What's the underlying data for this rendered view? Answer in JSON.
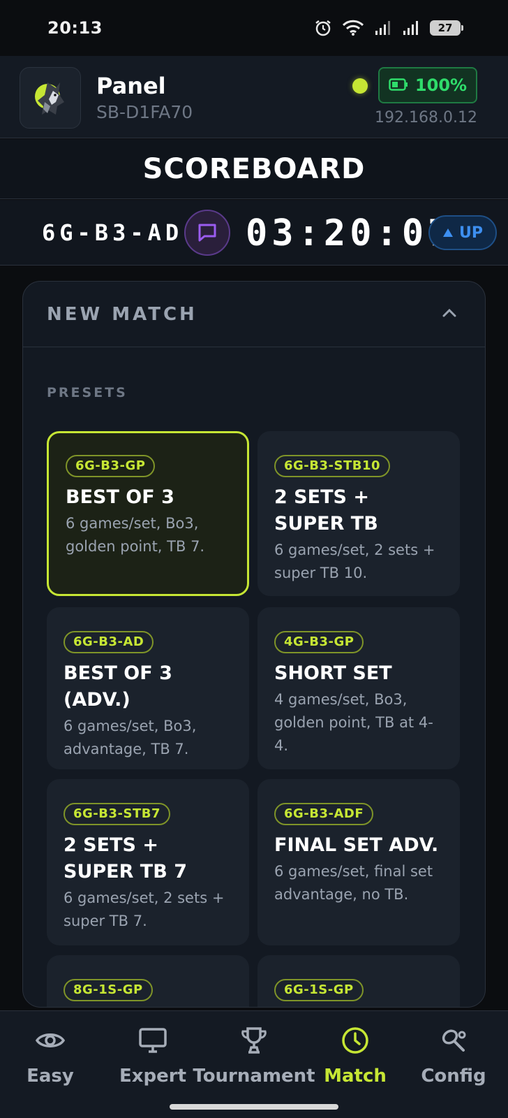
{
  "status_bar": {
    "time": "20:13",
    "battery_level": "27",
    "icons": [
      "alarm-icon",
      "wifi-icon",
      "signal-icon",
      "signal-icon",
      "battery-icon"
    ]
  },
  "header": {
    "title": "Panel",
    "device_id": "SB-D1FA70",
    "battery": "100%",
    "ip_address": "192.168.0.12",
    "connection_color": "#c6e634"
  },
  "page": {
    "title": "SCOREBOARD"
  },
  "timer": {
    "match_code": "6G-B3-AD",
    "clock": "03:20:07",
    "direction": "UP"
  },
  "new_match": {
    "title": "NEW MATCH",
    "presets_label": "PRESETS",
    "presets": [
      {
        "code": "6G-B3-GP",
        "title": "BEST OF 3",
        "description": "6 games/set, Bo3, golden point, TB 7.",
        "selected": true
      },
      {
        "code": "6G-B3-STB10",
        "title": "2 SETS + SUPER TB",
        "description": "6 games/set, 2 sets + super TB 10.",
        "selected": false
      },
      {
        "code": "6G-B3-AD",
        "title": "BEST OF 3 (ADV.)",
        "description": "6 games/set, Bo3, advantage, TB 7.",
        "selected": false
      },
      {
        "code": "4G-B3-GP",
        "title": "SHORT SET",
        "description": "4 games/set, Bo3, golden point, TB at 4-4.",
        "selected": false
      },
      {
        "code": "6G-B3-STB7",
        "title": "2 SETS + SUPER TB 7",
        "description": "6 games/set, 2 sets + super TB 7.",
        "selected": false
      },
      {
        "code": "6G-B3-ADF",
        "title": "FINAL SET ADV.",
        "description": "6 games/set, final set advantage, no TB.",
        "selected": false
      },
      {
        "code": "8G-1S-GP",
        "title": "",
        "description": "",
        "selected": false
      },
      {
        "code": "6G-1S-GP",
        "title": "",
        "description": "",
        "selected": false
      }
    ]
  },
  "nav": {
    "items": [
      {
        "label": "Easy",
        "icon": "eye-icon",
        "active": false
      },
      {
        "label": "Expert",
        "icon": "monitor-icon",
        "active": false
      },
      {
        "label": "Tournament",
        "icon": "trophy-icon",
        "active": false
      },
      {
        "label": "Match",
        "icon": "clock-icon",
        "active": true
      },
      {
        "label": "Config",
        "icon": "racket-icon",
        "active": false
      }
    ]
  },
  "colors": {
    "accent": "#c6e634",
    "background": "#0b0d10",
    "battery_ok": "#2fdc6b",
    "up_blue": "#3d8ff0",
    "chat_purple": "#9b5cf0"
  }
}
